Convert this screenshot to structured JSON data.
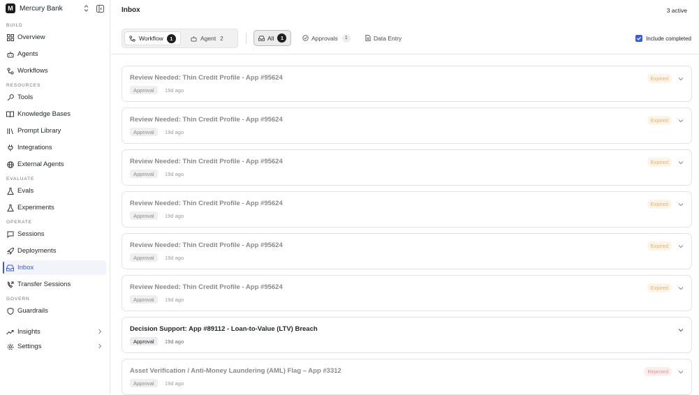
{
  "org": {
    "initial": "M",
    "name": "Mercury Bank"
  },
  "sidebar": {
    "sections": {
      "build": "BUILD",
      "resources": "RESOURCES",
      "evaluate": "EVALUATE",
      "operate": "OPERATE",
      "govern": "GOVERN"
    },
    "items": [
      {
        "label": "Overview",
        "icon": "grid-icon"
      },
      {
        "label": "Agents",
        "icon": "bot-icon"
      },
      {
        "label": "Workflows",
        "icon": "workflow-icon"
      },
      {
        "label": "Tools",
        "icon": "wrench-icon"
      },
      {
        "label": "Knowledge Bases",
        "icon": "book-icon"
      },
      {
        "label": "Prompt Library",
        "icon": "library-icon"
      },
      {
        "label": "Integrations",
        "icon": "plug-icon"
      },
      {
        "label": "External Agents",
        "icon": "globe-icon"
      },
      {
        "label": "Evals",
        "icon": "flask-icon"
      },
      {
        "label": "Experiments",
        "icon": "flask-icon"
      },
      {
        "label": "Sessions",
        "icon": "chat-icon"
      },
      {
        "label": "Deployments",
        "icon": "rocket-icon"
      },
      {
        "label": "Inbox",
        "icon": "inbox-icon"
      },
      {
        "label": "Transfer Sessions",
        "icon": "phone-transfer-icon"
      },
      {
        "label": "Guardrails",
        "icon": "shield-icon"
      },
      {
        "label": "Insights",
        "icon": "trend-icon"
      },
      {
        "label": "Settings",
        "icon": "gear-icon"
      }
    ]
  },
  "header": {
    "title": "Inbox",
    "active_count": "3 active"
  },
  "filters": {
    "source": {
      "workflow": {
        "label": "Workflow",
        "count": "1"
      },
      "agent": {
        "label": "Agent",
        "count": "2"
      }
    },
    "tabs": {
      "all": {
        "label": "All",
        "count": "1"
      },
      "approvals": {
        "label": "Approvals",
        "count": "1"
      },
      "data_entry": {
        "label": "Data Entry"
      }
    },
    "include_completed": {
      "label": "Include completed",
      "checked": true
    }
  },
  "colors": {
    "accent": "#3b5bdb",
    "expired": "#e3b27a",
    "rejected": "#e39494"
  },
  "cards": [
    {
      "title": "Review Needed: Thin Credit Profile - App #95624",
      "tag": "Approval",
      "time": "19d ago",
      "status": "Expired"
    },
    {
      "title": "Review Needed: Thin Credit Profile - App #95624",
      "tag": "Approval",
      "time": "19d ago",
      "status": "Expired"
    },
    {
      "title": "Review Needed: Thin Credit Profile - App #95624",
      "tag": "Approval",
      "time": "19d ago",
      "status": "Expired"
    },
    {
      "title": "Review Needed: Thin Credit Profile - App #95624",
      "tag": "Approval",
      "time": "19d ago",
      "status": "Expired"
    },
    {
      "title": "Review Needed: Thin Credit Profile - App #95624",
      "tag": "Approval",
      "time": "19d ago",
      "status": "Expired"
    },
    {
      "title": "Review Needed: Thin Credit Profile - App #95624",
      "tag": "Approval",
      "time": "19d ago",
      "status": "Expired"
    },
    {
      "title": "Decision Support: App #89112 - Loan-to-Value (LTV) Breach",
      "tag": "Approval",
      "time": "19d ago",
      "status": ""
    },
    {
      "title": "Asset Verification / Anti-Money Laundering (AML) Flag – App #3312",
      "tag": "Approval",
      "time": "19d ago",
      "status": "Rejected"
    }
  ]
}
